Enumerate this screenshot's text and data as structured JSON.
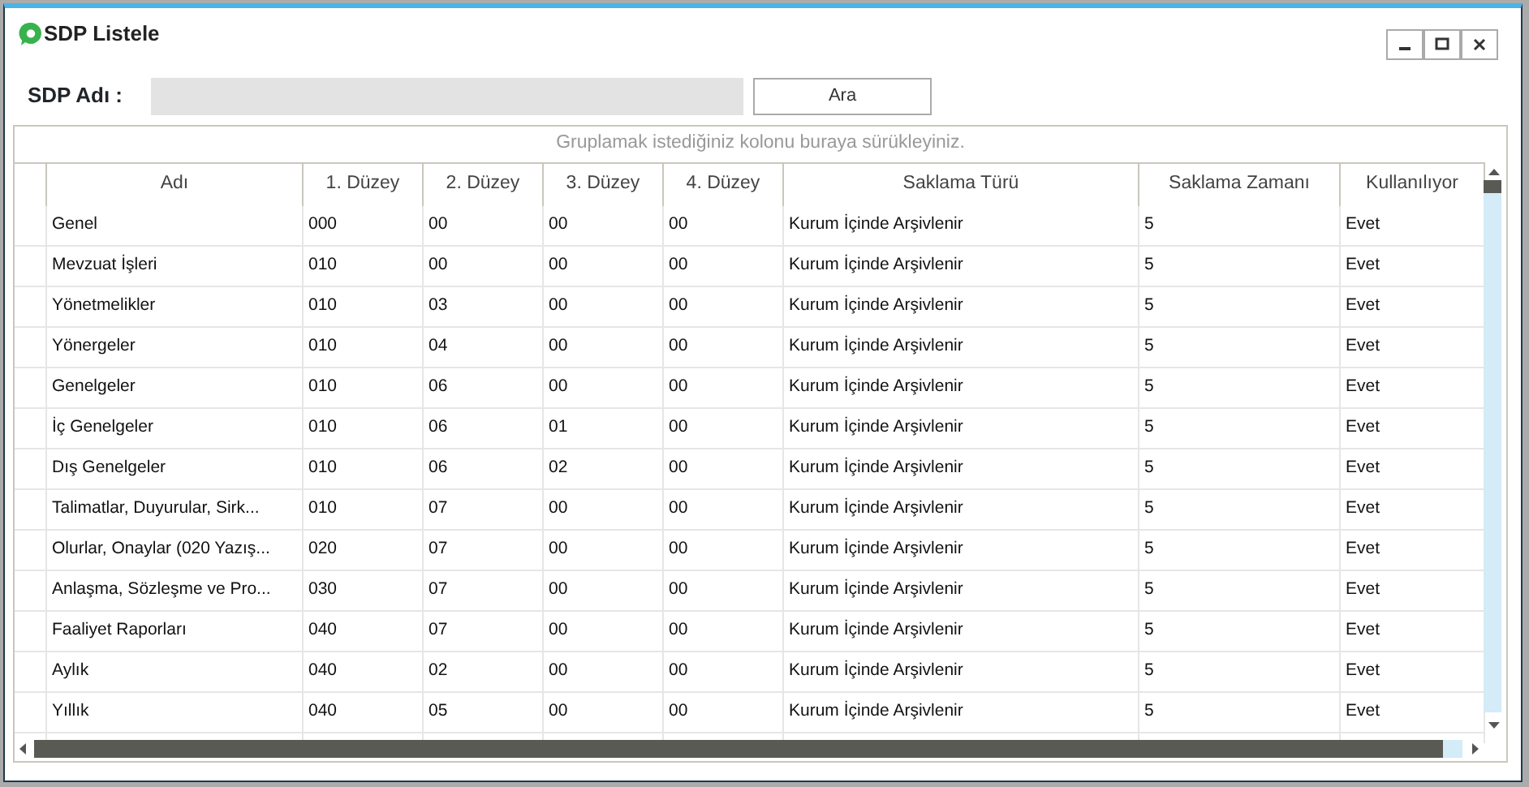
{
  "window": {
    "title": "SDP Listele"
  },
  "search": {
    "label": "SDP Adı :",
    "button": "Ara"
  },
  "group_panel": {
    "hint": "Gruplamak istediğiniz kolonu buraya sürükleyiniz."
  },
  "table": {
    "columns": [
      "Adı",
      "1. Düzey",
      "2. Düzey",
      "3. Düzey",
      "4. Düzey",
      "Saklama Türü",
      "Saklama Zamanı",
      "Kullanılıyor"
    ],
    "rows": [
      [
        "Genel",
        "000",
        "00",
        "00",
        "00",
        "Kurum İçinde Arşivlenir",
        "5",
        "Evet"
      ],
      [
        "Mevzuat İşleri",
        "010",
        "00",
        "00",
        "00",
        "Kurum İçinde Arşivlenir",
        "5",
        "Evet"
      ],
      [
        "Yönetmelikler",
        "010",
        "03",
        "00",
        "00",
        "Kurum İçinde Arşivlenir",
        "5",
        "Evet"
      ],
      [
        "Yönergeler",
        "010",
        "04",
        "00",
        "00",
        "Kurum İçinde Arşivlenir",
        "5",
        "Evet"
      ],
      [
        "Genelgeler",
        "010",
        "06",
        "00",
        "00",
        "Kurum İçinde Arşivlenir",
        "5",
        "Evet"
      ],
      [
        "İç Genelgeler",
        "010",
        "06",
        "01",
        "00",
        "Kurum İçinde Arşivlenir",
        "5",
        "Evet"
      ],
      [
        "Dış Genelgeler",
        "010",
        "06",
        "02",
        "00",
        "Kurum İçinde Arşivlenir",
        "5",
        "Evet"
      ],
      [
        "Talimatlar,  Duyurular,  Sirk...",
        "010",
        "07",
        "00",
        "00",
        "Kurum İçinde Arşivlenir",
        "5",
        "Evet"
      ],
      [
        "Olurlar, Onaylar (020 Yazış...",
        "020",
        "07",
        "00",
        "00",
        "Kurum İçinde Arşivlenir",
        "5",
        "Evet"
      ],
      [
        "Anlaşma,  Sözleşme  ve  Pro...",
        "030",
        "07",
        "00",
        "00",
        "Kurum İçinde Arşivlenir",
        "5",
        "Evet"
      ],
      [
        "Faaliyet Raporları",
        "040",
        "07",
        "00",
        "00",
        "Kurum İçinde Arşivlenir",
        "5",
        "Evet"
      ],
      [
        "Aylık",
        "040",
        "02",
        "00",
        "00",
        "Kurum İçinde Arşivlenir",
        "5",
        "Evet"
      ],
      [
        "Yıllık",
        "040",
        "05",
        "00",
        "00",
        "Kurum İçinde Arşivlenir",
        "5",
        "Evet"
      ]
    ]
  }
}
